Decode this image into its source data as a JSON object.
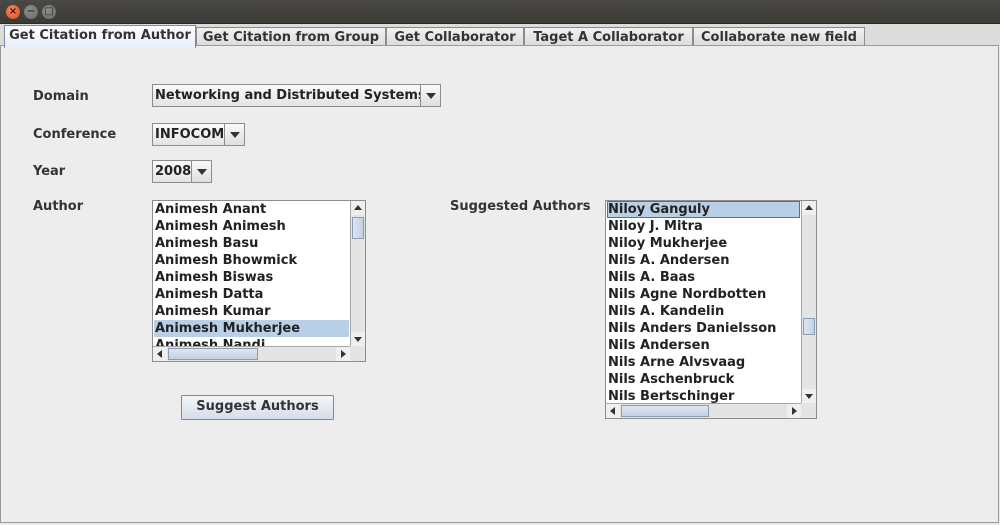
{
  "window": {
    "controls": {
      "close": "×",
      "minimize": "−",
      "maximize": "□"
    }
  },
  "tabs": [
    {
      "label": "Get Citation from Author",
      "active": true
    },
    {
      "label": "Get Citation from Group",
      "active": false
    },
    {
      "label": "Get Collaborator",
      "active": false
    },
    {
      "label": "Taget A Collaborator",
      "active": false
    },
    {
      "label": "Collaborate new field",
      "active": false
    }
  ],
  "form": {
    "domain_label": "Domain",
    "domain_value": "Networking and Distributed Systems",
    "conference_label": "Conference",
    "conference_value": "INFOCOM",
    "year_label": "Year",
    "year_value": "2008",
    "author_label": "Author",
    "suggested_label": "Suggested Authors",
    "suggest_button": "Suggest Authors"
  },
  "author_list": {
    "items": [
      "Animesh Anant",
      "Animesh Animesh",
      "Animesh Basu",
      "Animesh Bhowmick",
      "Animesh Biswas",
      "Animesh Datta",
      "Animesh Kumar",
      "Animesh Mukherjee",
      "Animesh Nandi"
    ],
    "selected": "Animesh Mukherjee"
  },
  "suggested_list": {
    "items": [
      "Niloy Ganguly",
      "Niloy J. Mitra",
      "Niloy Mukherjee",
      "Nils A. Andersen",
      "Nils A. Baas",
      "Nils Agne Nordbotten",
      "Nils A. Kandelin",
      "Nils Anders Danielsson",
      "Nils Andersen",
      "Nils Arne Alvsvaag",
      "Nils Aschenbruck",
      "Nils Bertschinger"
    ],
    "selected": "Niloy Ganguly"
  },
  "colors": {
    "selection": "#b8cfe5",
    "panel": "#ededed",
    "titlebar": "#3b3a36"
  }
}
